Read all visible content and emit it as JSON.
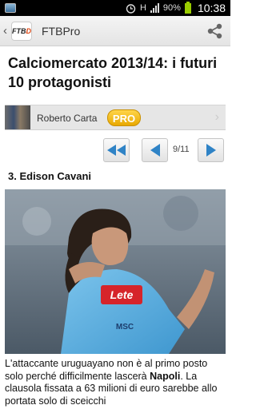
{
  "status_bar": {
    "network": "H",
    "battery": "90%",
    "time": "10:38"
  },
  "app_bar": {
    "logo_text_1": "FTB",
    "logo_text_2": "D",
    "title": "FTBPro"
  },
  "article": {
    "headline": "Calciomercato 2013/14: i futuri 10 protagonisti",
    "author": "Roberto Carta",
    "author_badge": "PRO",
    "page_indicator": "9/11",
    "section_title": "3. Edison Cavani",
    "photo_text": {
      "sponsor": "Lete",
      "shirt_logo": "MSC"
    },
    "body_before": "L'attaccante uruguayano non è al primo posto solo perché difficilmente lascerà ",
    "body_bold": "Napoli",
    "body_after": ". La clausola fissata a 63 milioni di euro sarebbe allo portata solo di sceicchi"
  },
  "colors": {
    "accent_blue": "#2f83c6",
    "pro_badge": "#f0b400"
  }
}
